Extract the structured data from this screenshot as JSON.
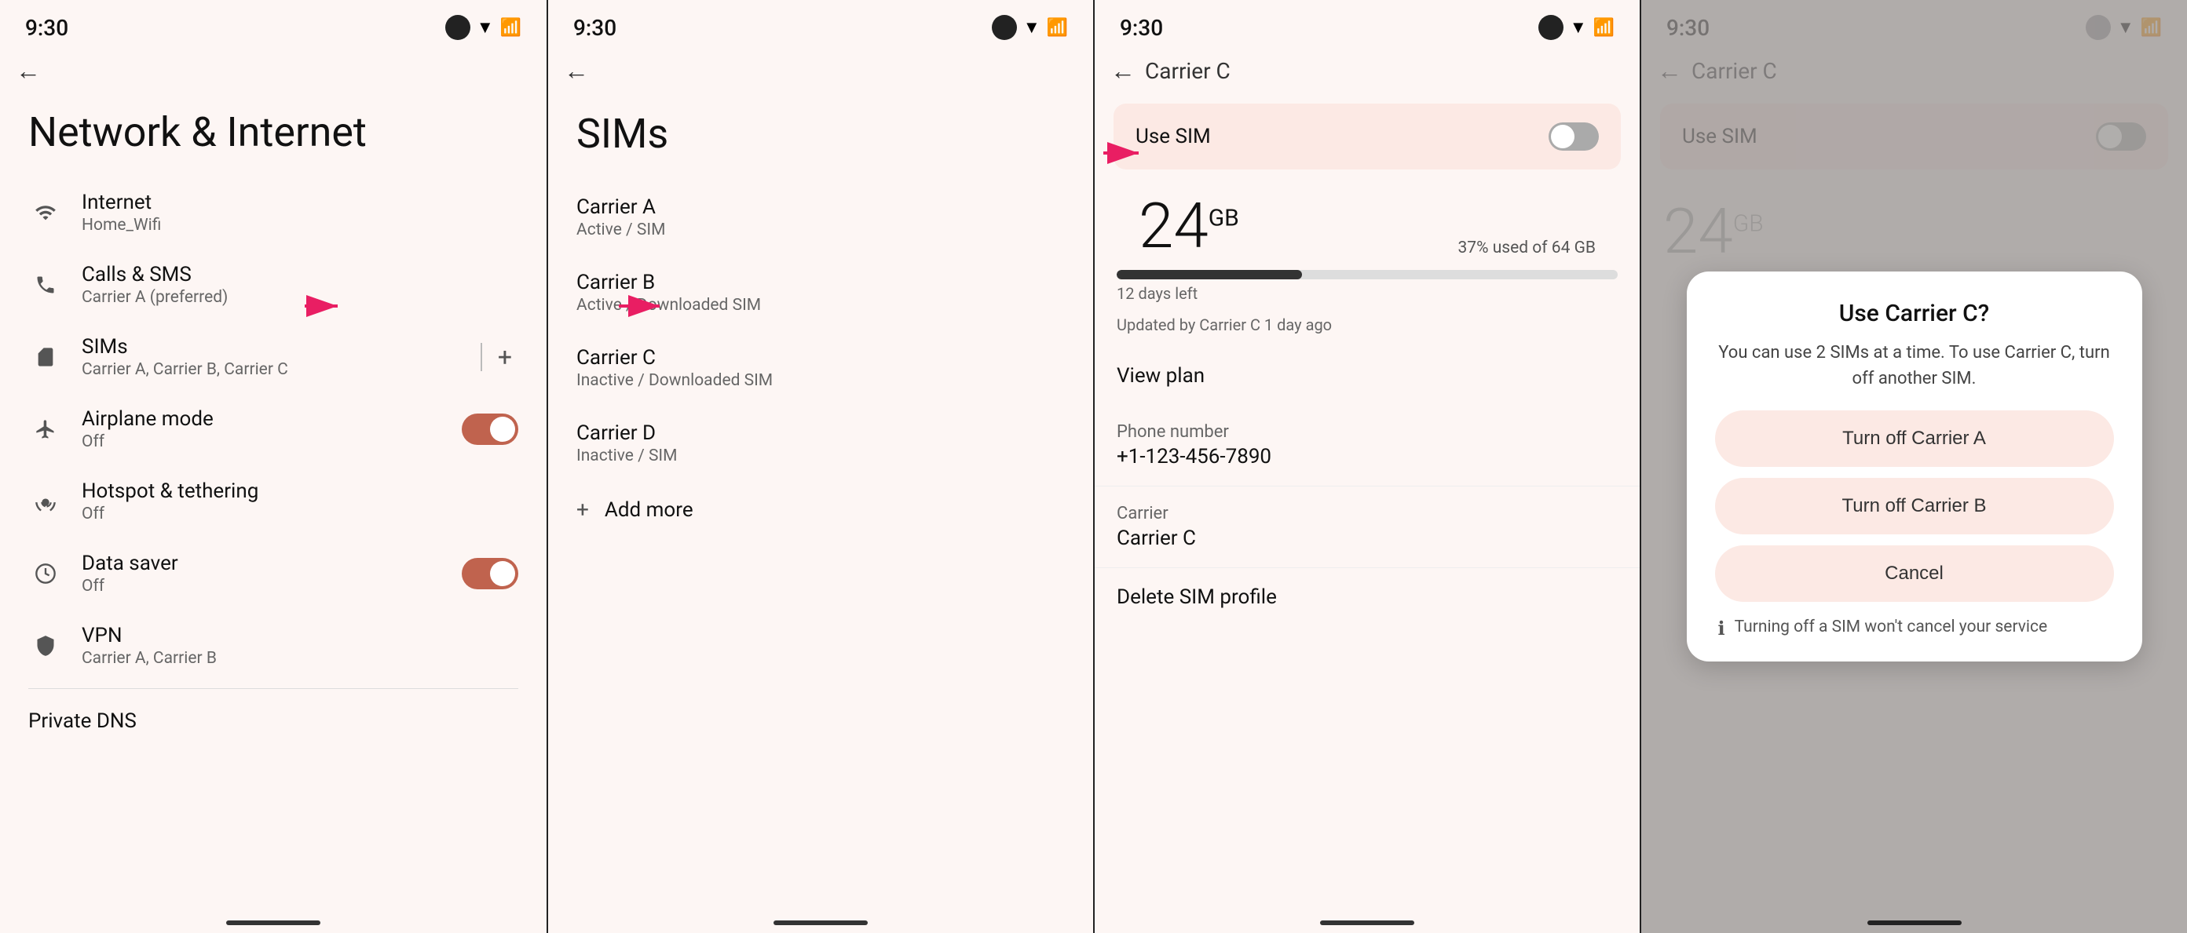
{
  "panels": {
    "p1": {
      "status_time": "9:30",
      "title": "Network & Internet",
      "menu_items": [
        {
          "id": "internet",
          "icon": "wifi",
          "label": "Internet",
          "sub": "Home_Wifi"
        },
        {
          "id": "calls_sms",
          "icon": "phone",
          "label": "Calls & SMS",
          "sub": "Carrier A (preferred)"
        },
        {
          "id": "sims",
          "icon": "sim",
          "label": "SIMs",
          "sub": "Carrier A, Carrier B, Carrier C",
          "has_add": true
        },
        {
          "id": "airplane",
          "icon": "flight",
          "label": "Airplane mode",
          "sub": "Off",
          "toggle": "on"
        },
        {
          "id": "hotspot",
          "icon": "hotspot",
          "label": "Hotspot & tethering",
          "sub": "Off"
        },
        {
          "id": "datasaver",
          "icon": "data",
          "label": "Data saver",
          "sub": "Off",
          "toggle": "on"
        },
        {
          "id": "vpn",
          "icon": "vpn",
          "label": "VPN",
          "sub": "Carrier A, Carrier B"
        }
      ],
      "bottom_item": "Private DNS",
      "back_visible": true
    },
    "p2": {
      "status_time": "9:30",
      "title": "SIMs",
      "carriers": [
        {
          "id": "carrier_a",
          "name": "Carrier A",
          "status": "Active / SIM"
        },
        {
          "id": "carrier_b",
          "name": "Carrier B",
          "status": "Active / Downloaded SIM"
        },
        {
          "id": "carrier_c",
          "name": "Carrier C",
          "status": "Inactive / Downloaded SIM",
          "highlighted": true
        },
        {
          "id": "carrier_d",
          "name": "Carrier D",
          "status": "Inactive / SIM"
        }
      ],
      "add_more": "Add more"
    },
    "p3": {
      "status_time": "9:30",
      "title": "Carrier C",
      "use_sim_label": "Use SIM",
      "data_amount": "24",
      "data_unit": "GB",
      "data_used_pct": 37,
      "data_total": "64 GB",
      "data_used_label": "37% used of 64 GB",
      "days_left": "12 days left",
      "updated_by": "Updated by Carrier C 1 day ago",
      "progress_pct": 37,
      "items": [
        {
          "id": "view_plan",
          "label": "View plan"
        },
        {
          "id": "phone_number",
          "label": "Phone number",
          "value": "+1-123-456-7890"
        },
        {
          "id": "carrier",
          "label": "Carrier",
          "value": "Carrier C"
        }
      ],
      "delete_label": "Delete SIM profile"
    },
    "p4": {
      "status_time": "9:30",
      "title": "Carrier C",
      "use_sim_label": "Use SIM",
      "dialog": {
        "title": "Use Carrier C?",
        "body": "You can use 2 SIMs at a time. To use Carrier C, turn off another SIM.",
        "btn1": "Turn off Carrier A",
        "btn2": "Turn off Carrier B",
        "btn3": "Cancel",
        "footer": "Turning off a SIM won't cancel your service"
      }
    }
  },
  "arrows": {
    "arrow1_label": "→",
    "arrow2_label": "→"
  }
}
